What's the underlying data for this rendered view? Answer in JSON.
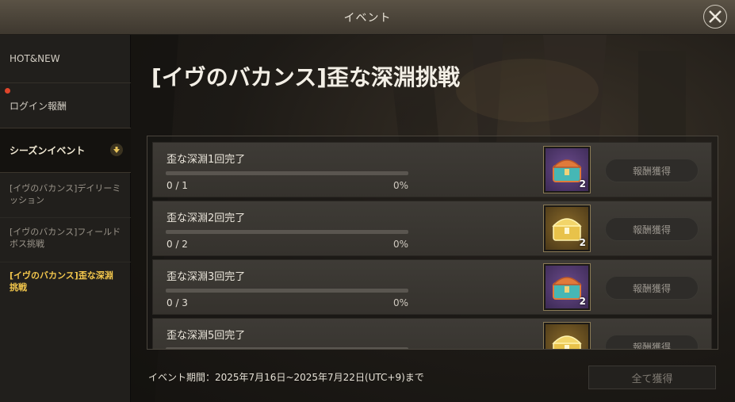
{
  "window": {
    "title": "イベント"
  },
  "sidebar": {
    "items": [
      {
        "label": "HOT&NEW"
      },
      {
        "label": "ログイン報酬"
      },
      {
        "label": "シーズンイベント"
      }
    ],
    "sub_items": [
      {
        "label": "[イヴのバカンス]デイリーミッション"
      },
      {
        "label": "[イヴのバカンス]フィールドボス挑戦"
      },
      {
        "label": "[イヴのバカンス]歪な深淵挑戦"
      }
    ]
  },
  "event": {
    "title": "[イヴのバカンス]歪な深淵挑戦",
    "missions": [
      {
        "name": "歪な深淵1回完了",
        "progress": "0 / 1",
        "percent": "0%",
        "reward_icon": "purple-chest-icon",
        "reward_qty": "2",
        "button": "報酬獲得"
      },
      {
        "name": "歪な深淵2回完了",
        "progress": "0 / 2",
        "percent": "0%",
        "reward_icon": "gold-chest-icon",
        "reward_qty": "2",
        "button": "報酬獲得"
      },
      {
        "name": "歪な深淵3回完了",
        "progress": "0 / 3",
        "percent": "0%",
        "reward_icon": "purple-chest-icon",
        "reward_qty": "2",
        "button": "報酬獲得"
      },
      {
        "name": "歪な深淵5回完了",
        "progress": "",
        "percent": "",
        "reward_icon": "gold-chest-icon",
        "reward_qty": "",
        "button": "報酬獲得"
      }
    ],
    "period": "イベント期間：2025年7月16日~2025年7月22日(UTC+9)まで",
    "claim_all": "全て獲得"
  },
  "colors": {
    "active": "#f2c64c",
    "notification_dot": "#e0452b",
    "progress_fill": "#c9a24a"
  }
}
